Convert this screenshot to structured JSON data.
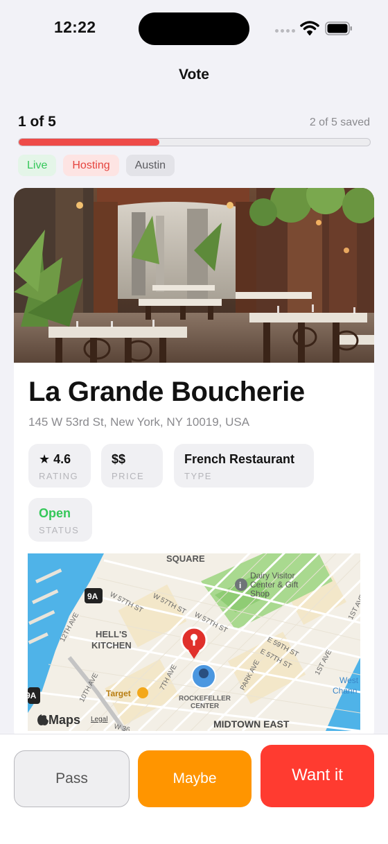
{
  "status_bar": {
    "time": "12:22"
  },
  "nav": {
    "title": "Vote"
  },
  "progress": {
    "count_label": "1 of 5",
    "saved_label": "2 of 5 saved",
    "fraction": 0.4
  },
  "chips": [
    {
      "label": "Live",
      "color": "#34c759"
    },
    {
      "label": "Hosting",
      "color": "#e5433e"
    },
    {
      "label": "Austin",
      "color": "#5b5b60"
    }
  ],
  "restaurant": {
    "name": "La Grande Boucherie",
    "address": "145 W 53rd St, New York, NY 10019, USA",
    "stats": [
      {
        "value": "★ 4.6",
        "label": "RATING"
      },
      {
        "value": "$$",
        "label": "PRICE"
      },
      {
        "value": "French Restaurant",
        "label": "TYPE"
      },
      {
        "value": "Open",
        "label": "STATUS"
      }
    ]
  },
  "map": {
    "labels": {
      "square": "SQUARE",
      "route_9a": "9A",
      "dairy_1": "Dairy Visitor",
      "dairy_2": "Center & Gift",
      "dairy_3": "Shop",
      "hells_1": "HELL'S",
      "hells_2": "KITCHEN",
      "target": "Target",
      "rock_1": "ROCKEFELLER",
      "rock_2": "CENTER",
      "midtown": "MIDTOWN EAST",
      "legal": "Legal",
      "maps": "Maps",
      "w57_a": "W 57TH ST",
      "w57_b": "W 57TH ST",
      "w57_c": "W 57TH ST",
      "e59": "E 59TH ST",
      "e57": "E 57TH ST",
      "ave12": "12TH AVE",
      "ave7": "7TH AVE",
      "ave10": "10TH AVE",
      "park": "PARK AVE",
      "ave1": "1ST AVE",
      "ave1b": "1ST AVE",
      "west": "West",
      "chann": "Chann",
      "w36": "W 36"
    }
  },
  "actions": {
    "pass": "Pass",
    "maybe": "Maybe",
    "want": "Want it"
  },
  "colors": {
    "accent_red": "#ff3b30",
    "orange": "#ff9500",
    "green": "#34c759"
  }
}
